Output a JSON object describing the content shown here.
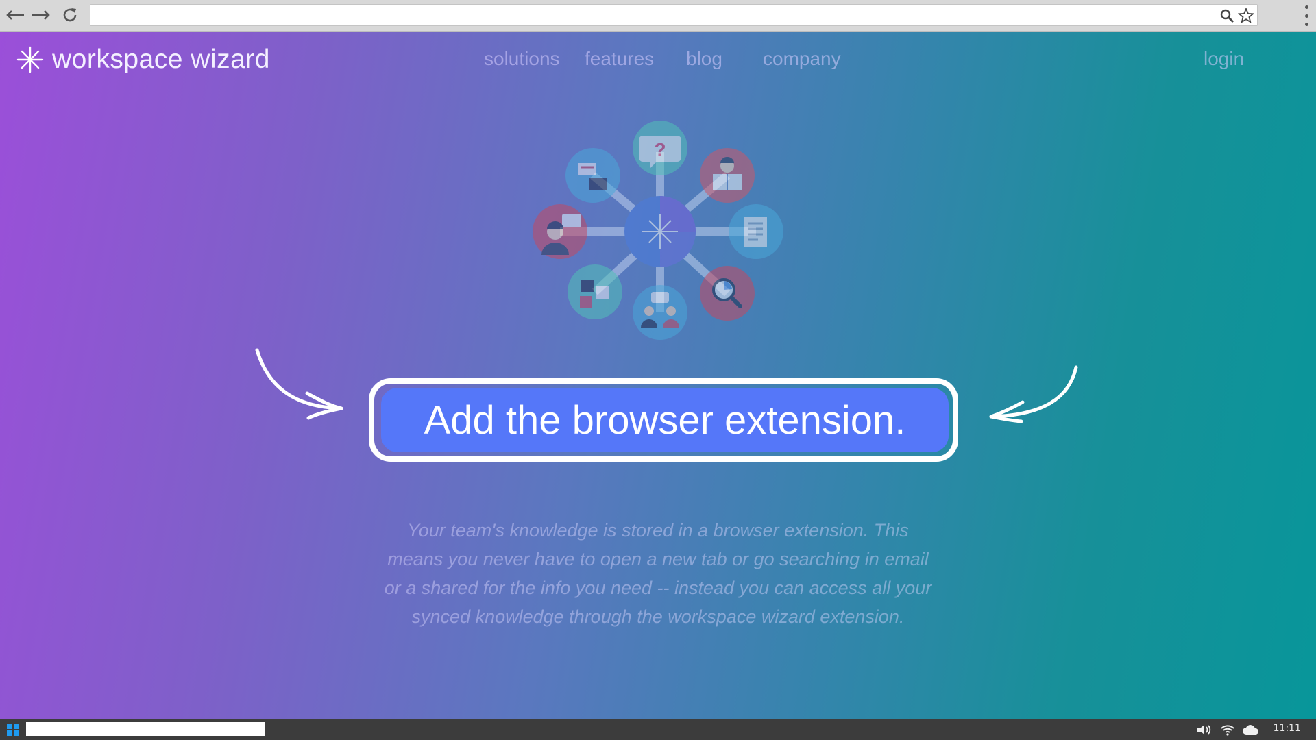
{
  "browser": {
    "back_icon": "arrow-left-icon",
    "forward_icon": "arrow-right-icon",
    "reload_icon": "reload-icon",
    "address_value": "",
    "search_icon": "search-icon",
    "bookmark_icon": "star-icon",
    "menu_icon": "kebab-menu-icon"
  },
  "brand": {
    "logo_icon": "sparkle-icon",
    "name": "workspace wizard"
  },
  "nav": {
    "items": [
      {
        "label": "solutions"
      },
      {
        "label": "features"
      },
      {
        "label": "blog"
      },
      {
        "label": "company"
      }
    ],
    "login": "login"
  },
  "hero": {
    "hub_icons": [
      "question-bubble-icon",
      "reader-book-icon",
      "document-list-icon",
      "magnify-chart-icon",
      "meeting-people-icon",
      "puzzle-pieces-icon",
      "person-chat-icon",
      "cards-transfer-icon"
    ],
    "cta_label": "Add the browser extension.",
    "description": "Your team's knowledge is stored in a browser extension. This means you never have to open a new tab or go searching in email or a shared for the info you need -- instead you can access all your synced knowledge through the workspace wizard extension."
  },
  "colors": {
    "gradient_start": "#9b4fd9",
    "gradient_end": "#08969a",
    "cta_fill": "#5577f9",
    "cta_border": "#ffffff"
  },
  "taskbar": {
    "start_icon": "windows-logo-icon",
    "search_value": "",
    "volume_icon": "volume-icon",
    "wifi_icon": "wifi-icon",
    "cloud_icon": "cloud-icon",
    "clock": "11:11"
  }
}
